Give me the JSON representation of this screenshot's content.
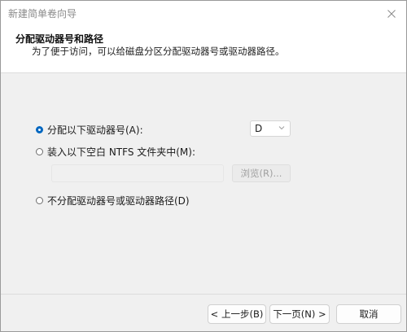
{
  "window": {
    "title": "新建简单卷向导",
    "close_icon": "close-icon"
  },
  "header": {
    "title": "分配驱动器号和路径",
    "subtitle": "为了便于访问，可以给磁盘分区分配驱动器号或驱动器路径。"
  },
  "options": {
    "assign_letter": {
      "label": "分配以下驱动器号(A):",
      "checked": true
    },
    "mount_folder": {
      "label": "装入以下空白 NTFS 文件夹中(M):",
      "checked": false
    },
    "no_assign": {
      "label": "不分配驱动器号或驱动器路径(D)",
      "checked": false
    }
  },
  "drive_letter": {
    "selected": "D"
  },
  "folder_path": {
    "value": ""
  },
  "buttons": {
    "browse": "浏览(R)...",
    "back": "< 上一步(B)",
    "next": "下一页(N) >",
    "cancel": "取消"
  },
  "colors": {
    "accent": "#0067c0",
    "header_bg": "#ffffff",
    "body_bg": "#f0f0f0"
  }
}
